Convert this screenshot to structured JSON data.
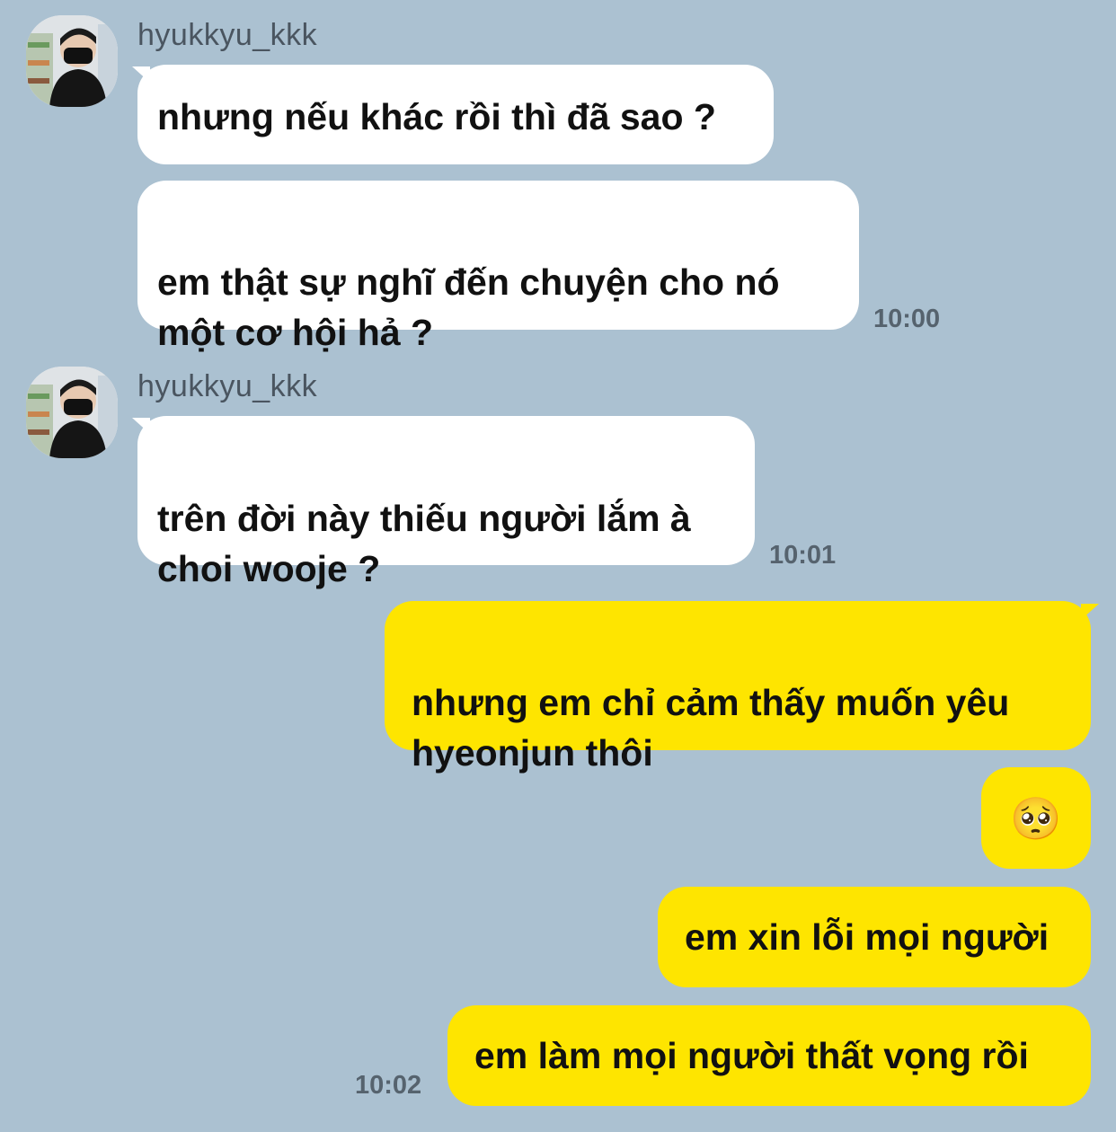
{
  "group1": {
    "sender": "hyukkyu_kkk",
    "messages": [
      "nhưng nếu khác rồi thì đã sao ?",
      "em thật sự nghĩ đến chuyện cho nó\nmột cơ hội hả ?"
    ],
    "time": "10:00"
  },
  "group2": {
    "sender": "hyukkyu_kkk",
    "messages": [
      "trên đời này thiếu người lắm à\nchoi wooje ?"
    ],
    "time": "10:01"
  },
  "group3": {
    "messages": [
      "nhưng em chỉ cảm thấy muốn yêu\nhyeonjun thôi",
      "🥺",
      "em xin lỗi mọi người",
      "em làm mọi người thất vọng rồi"
    ],
    "time": "10:02"
  },
  "icons": {
    "avatar": "profile-photo",
    "incoming_bubble_color": "#ffffff",
    "outgoing_bubble_color": "#fee500",
    "background": "#abc1d1"
  }
}
